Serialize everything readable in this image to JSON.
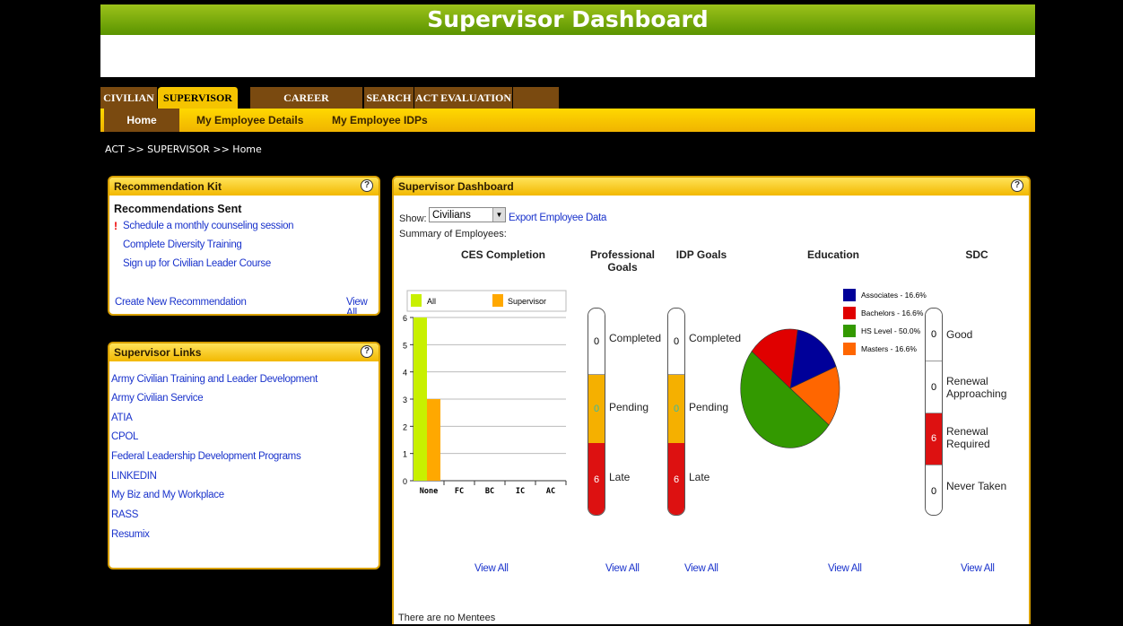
{
  "page_title": "Supervisor Dashboard",
  "tabs": [
    "CIVILIAN",
    "SUPERVISOR",
    "CAREER RESOURCES",
    "SEARCH",
    "ACT EVALUATION"
  ],
  "subnav": [
    "Home",
    "My Employee Details",
    "My Employee IDPs"
  ],
  "breadcrumb": "ACT  >>  SUPERVISOR  >>  Home",
  "rec_kit": {
    "title": "Recommendation Kit",
    "sent_heading": "Recommendations Sent",
    "alert_mark": "!",
    "items": [
      "Schedule a monthly counseling session",
      "Complete Diversity Training",
      "Sign up for Civilian Leader Course"
    ],
    "create": "Create New Recommendation",
    "view_all": "View All"
  },
  "sup_links": {
    "title": "Supervisor Links",
    "items": [
      "Army Civilian Training and Leader Development",
      "Army Civilian Service",
      "ATIA",
      "CPOL",
      "Federal Leadership Development Programs",
      "LINKEDIN",
      "My Biz and My Workplace",
      "RASS",
      "Resumix"
    ]
  },
  "dashboard": {
    "title": "Supervisor Dashboard",
    "show_label": "Show:",
    "show_value": "Civilians",
    "export": "Export Employee Data",
    "summary": "Summary of Employees:",
    "col_headers": [
      "CES Completion",
      "Professional Goals",
      "IDP Goals",
      "Education",
      "SDC"
    ],
    "view_all": "View All",
    "footer": "There are no Mentees",
    "help": "?"
  },
  "prof_goals": {
    "completed": 0,
    "pending": 0,
    "late": 6,
    "labels": [
      "Completed",
      "Pending",
      "Late"
    ]
  },
  "idp_goals": {
    "completed": 0,
    "pending": 0,
    "late": 6,
    "labels": [
      "Completed",
      "Pending",
      "Late"
    ]
  },
  "sdc": {
    "values": [
      0,
      0,
      6,
      0
    ],
    "labels": [
      "Good",
      "Renewal Approaching",
      "Renewal Required",
      "Never Taken"
    ]
  },
  "colors": {
    "all": "#c8f000",
    "supervisor": "#ffa800",
    "associates": "#000099",
    "bachelors": "#e00000",
    "hs_level": "#339900",
    "masters": "#ff6600",
    "pending": "#f5b000",
    "late": "#dd1111"
  },
  "chart_data": [
    {
      "type": "bar",
      "title": "CES Completion",
      "categories": [
        "None",
        "FC",
        "BC",
        "IC",
        "AC"
      ],
      "series": [
        {
          "name": "All",
          "values": [
            6,
            0,
            0,
            0,
            0
          ]
        },
        {
          "name": "Supervisor",
          "values": [
            3,
            0,
            0,
            0,
            0
          ]
        }
      ],
      "ylim": [
        0,
        6
      ],
      "yticks": [
        0,
        1,
        2,
        3,
        4,
        5,
        6
      ],
      "grid": true,
      "legend": "top"
    },
    {
      "type": "pie",
      "title": "Education",
      "labels": [
        "Associates - 16.6%",
        "Bachelors - 16.6%",
        "HS Level - 50.0%",
        "Masters - 16.6%"
      ],
      "values": [
        16.6,
        16.6,
        50.0,
        16.6
      ],
      "legend": "right"
    }
  ]
}
